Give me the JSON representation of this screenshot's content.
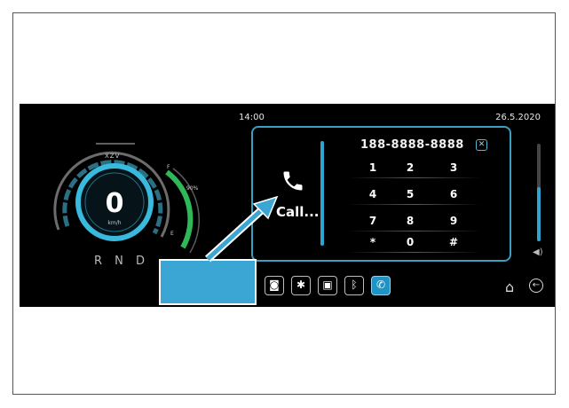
{
  "status": {
    "time": "14:00",
    "date": "26.5.2020"
  },
  "cluster": {
    "brand": "XZV",
    "speed": "0",
    "unit": "km/h",
    "gear_selector": "R N D",
    "fuel_full_label": "F",
    "fuel_empty_label": "E",
    "temp_label": "90%"
  },
  "call_screen": {
    "status_label": "Call...",
    "number": "188-8888-8888",
    "close_symbol": "✕",
    "keys": [
      "1",
      "2",
      "3",
      "4",
      "5",
      "6",
      "7",
      "8",
      "9",
      "*",
      "0",
      "#"
    ]
  },
  "volume": {
    "level": 0.55
  },
  "dock": {
    "items": [
      {
        "icon": "camera-icon",
        "glyph": "◙"
      },
      {
        "icon": "settings-icon",
        "glyph": "✱"
      },
      {
        "icon": "apps-icon",
        "glyph": "▣"
      },
      {
        "icon": "bluetooth-icon",
        "glyph": "ᛒ"
      },
      {
        "icon": "phone-icon",
        "glyph": "✆",
        "active": true
      }
    ]
  },
  "colors": {
    "accent": "#2fa4cf",
    "callout": "#3ba6d3",
    "screen_bg": "#000000"
  }
}
